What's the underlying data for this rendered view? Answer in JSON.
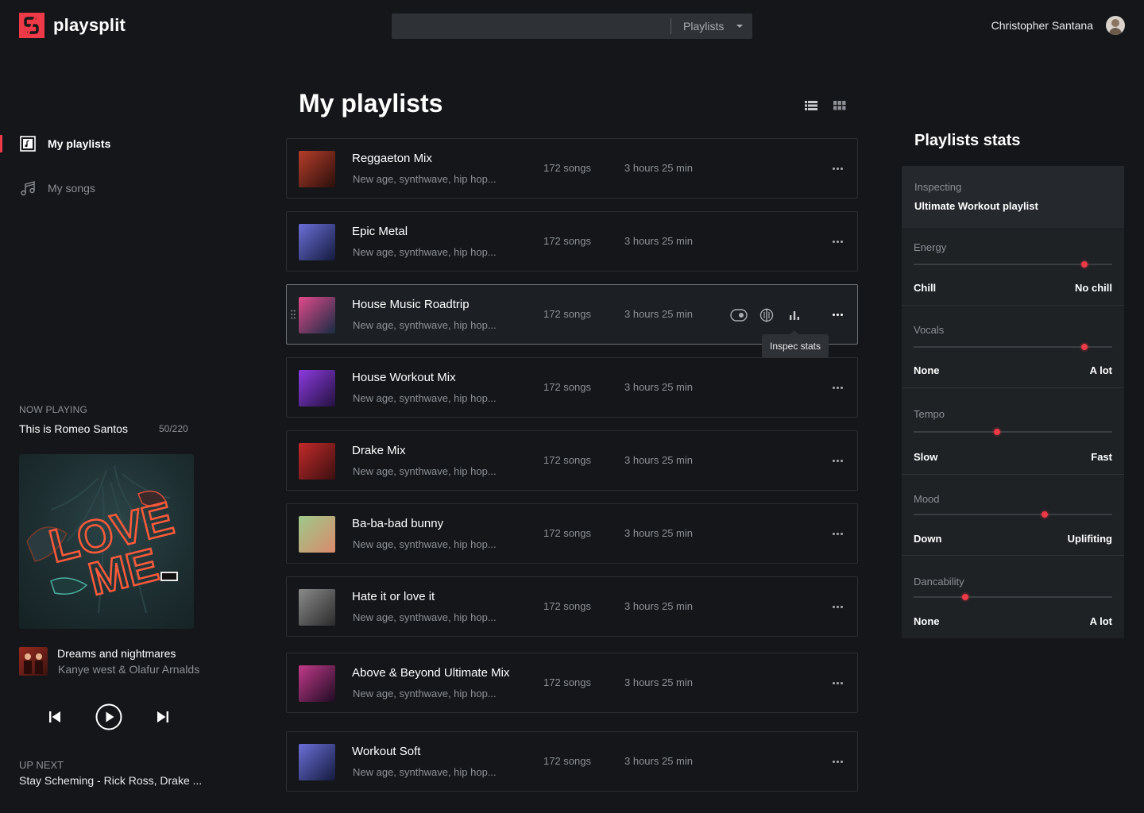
{
  "app": {
    "name": "playsplit",
    "brand_color": "#ee3a46"
  },
  "search": {
    "value": "",
    "placeholder": "",
    "scope": "Playlists"
  },
  "user": {
    "name": "Christopher Santana"
  },
  "sidebar": {
    "items": [
      {
        "label": "My playlists",
        "icon": "playlist-icon",
        "active": true
      },
      {
        "label": "My songs",
        "icon": "music-note-icon",
        "active": false
      }
    ]
  },
  "now_playing": {
    "caption": "NOW PLAYING",
    "playlist": "This is Romeo Santos",
    "position": "50/220",
    "track_title": "Dreams and nightmares",
    "track_artist": "Kanye west & Olafur Arnalds",
    "up_next_caption": "UP NEXT",
    "up_next_track": "Stay Scheming - Rick Ross, Drake ..."
  },
  "main": {
    "title": "My playlists",
    "playlists": [
      {
        "name": "Reggaeton Mix",
        "desc": "New age, synthwave, hip hop...",
        "songs": "172 songs",
        "duration": "3 hours 25 min",
        "thumb": [
          "#b63d2a",
          "#2a0f0c"
        ]
      },
      {
        "name": "Epic Metal",
        "desc": "New age, synthwave, hip hop...",
        "songs": "172 songs",
        "duration": "3 hours 25 min",
        "thumb": [
          "#6b6fd8",
          "#141a3d"
        ]
      },
      {
        "name": "House Music Roadtrip",
        "desc": "New age, synthwave, hip hop...",
        "songs": "172 songs",
        "duration": "3 hours 25 min",
        "thumb": [
          "#e24a8a",
          "#162c44"
        ]
      },
      {
        "name": "House Workout Mix",
        "desc": "New age, synthwave, hip hop...",
        "songs": "172 songs",
        "duration": "3 hours 25 min",
        "thumb": [
          "#8c3ae0",
          "#23123f"
        ]
      },
      {
        "name": "Drake Mix",
        "desc": "New age, synthwave, hip hop...",
        "songs": "172 songs",
        "duration": "3 hours 25 min",
        "thumb": [
          "#c42a2a",
          "#3b0f10"
        ]
      },
      {
        "name": "Ba-ba-bad bunny",
        "desc": "New age, synthwave, hip hop...",
        "songs": "172 songs",
        "duration": "3 hours 25 min",
        "thumb": [
          "#9ec98a",
          "#d98a6c"
        ]
      },
      {
        "name": "Hate it or love it",
        "desc": "New age, synthwave, hip hop...",
        "songs": "172 songs",
        "duration": "3 hours 25 min",
        "thumb": [
          "#8a8a8a",
          "#2b2b2b"
        ]
      },
      {
        "name": "Above & Beyond Ultimate Mix",
        "desc": "New age, synthwave, hip hop...",
        "songs": "172 songs",
        "duration": "3 hours 25 min",
        "thumb": [
          "#c23a8a",
          "#1d0b22"
        ]
      },
      {
        "name": "Workout Soft",
        "desc": "New age, synthwave, hip hop...",
        "songs": "172 songs",
        "duration": "3 hours 25 min",
        "thumb": [
          "#6b6fd8",
          "#141a3d"
        ]
      }
    ],
    "tooltip": "Inspec stats"
  },
  "stats": {
    "title": "Playlists stats",
    "inspecting_caption": "Inspecting",
    "inspecting_value": "Ultimate Workout playlist",
    "metrics": [
      {
        "label": "Energy",
        "min": "Chill",
        "max": "No chill",
        "level": 0.86
      },
      {
        "label": "Vocals",
        "min": "None",
        "max": "A lot",
        "level": 0.86
      },
      {
        "label": "Tempo",
        "min": "Slow",
        "max": "Fast",
        "level": 0.42
      },
      {
        "label": "Mood",
        "min": "Down",
        "max": "Uplifiting",
        "level": 0.66
      },
      {
        "label": "Dancability",
        "min": "None",
        "max": "A lot",
        "level": 0.26
      }
    ]
  }
}
